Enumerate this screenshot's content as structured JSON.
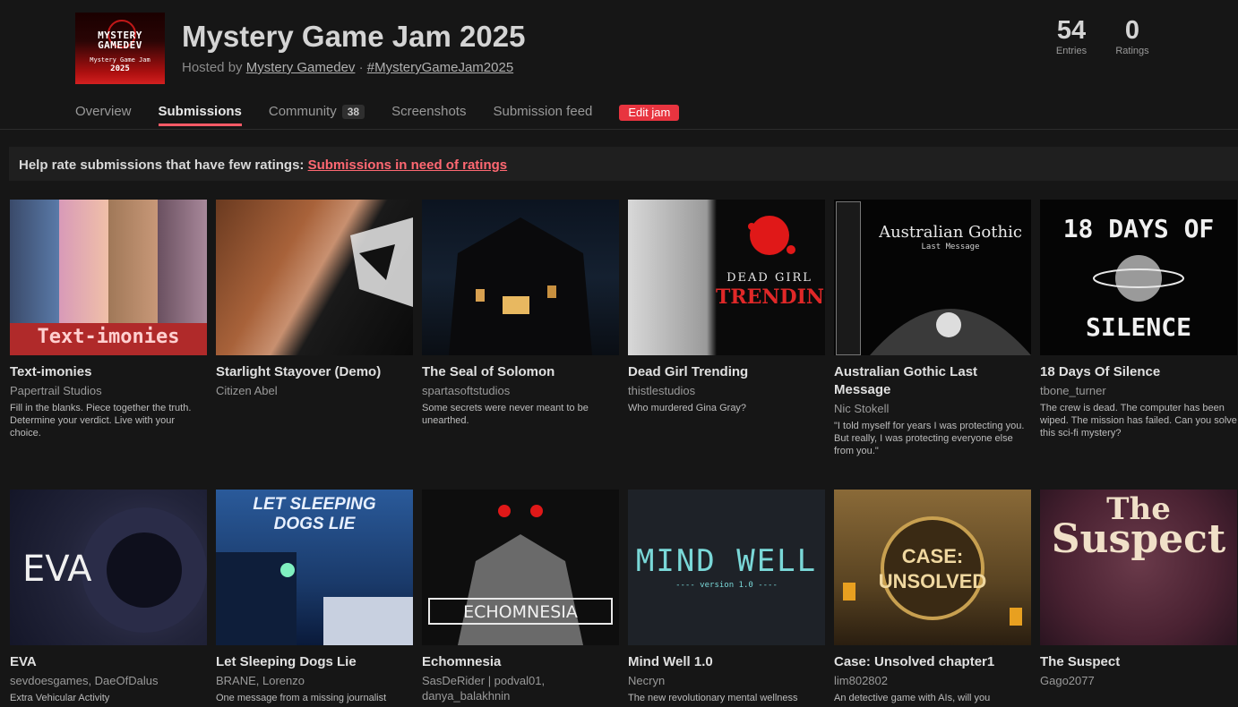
{
  "jam": {
    "title": "Mystery Game Jam 2025",
    "hosted_prefix": "Hosted by ",
    "host": "Mystery Gamedev",
    "separator": " · ",
    "hashtag": "#MysteryGameJam2025",
    "logo": {
      "line1": "MYSTERY",
      "line2": "GAMEDEV",
      "line3": "Mystery Game Jam",
      "line4": "2025"
    }
  },
  "stats": [
    {
      "num": "54",
      "label": "Entries"
    },
    {
      "num": "0",
      "label": "Ratings"
    }
  ],
  "tabs": {
    "overview": "Overview",
    "submissions": "Submissions",
    "community": "Community",
    "community_count": "38",
    "screenshots": "Screenshots",
    "feed": "Submission feed",
    "edit": "Edit jam"
  },
  "help": {
    "text": "Help rate submissions that have few ratings: ",
    "link": "Submissions in need of ratings"
  },
  "colors": {
    "accent": "#ff5a66",
    "button": "#e8343f",
    "background": "#161616"
  },
  "games": [
    {
      "title": "Text-imonies",
      "author": "Papertrail Studios",
      "desc": "Fill in the blanks. Piece together the truth. Determine your verdict. Live with your choice.",
      "thumb_text": "Text-imonies"
    },
    {
      "title": "Starlight Stayover (Demo)",
      "author": "Citizen Abel",
      "desc": ""
    },
    {
      "title": "The Seal of Solomon",
      "author": "spartasoftstudios",
      "desc": "Some secrets were never meant to be unearthed."
    },
    {
      "title": "Dead Girl Trending",
      "author": "thistlestudios",
      "desc": "Who murdered Gina Gray?",
      "thumb_text1": "DEAD GIRL",
      "thumb_text2": "TRENDING"
    },
    {
      "title": "Australian Gothic Last Message",
      "author": "Nic Stokell",
      "desc": "\"I told myself for years I was protecting you. But really, I was protecting everyone else from you.\"",
      "thumb_text1": "Australian Gothic",
      "thumb_text2": "Last Message"
    },
    {
      "title": "18 Days Of Silence",
      "author": "tbone_turner",
      "desc": "The crew is dead. The computer has been wiped. The mission has failed. Can you solve this sci-fi mystery?",
      "thumb_text1": "18 DAYS OF",
      "thumb_text2": "SILENCE"
    },
    {
      "title": "EVA",
      "author": "sevdoesgames, DaeOfDalus",
      "desc": "Extra Vehicular Activity",
      "thumb_text": "EVA"
    },
    {
      "title": "Let Sleeping Dogs Lie",
      "author": "BRANE, Lorenzo",
      "desc": "One message from a missing journalist",
      "thumb_text1": "LET SLEEPING",
      "thumb_text2": "DOGS LIE"
    },
    {
      "title": "Echomnesia",
      "author": "SasDeRider | podval01, danya_balakhnin",
      "desc": "",
      "thumb_text": "ECHOMNESIA"
    },
    {
      "title": "Mind Well 1.0",
      "author": "Necryn",
      "desc": "The new revolutionary mental wellness",
      "thumb_text1": "MIND WELL",
      "thumb_text2": "---- version 1.0 ----"
    },
    {
      "title": "Case: Unsolved chapter1",
      "author": "lim802802",
      "desc": "An detective game with AIs, will you",
      "thumb_text1": "CASE:",
      "thumb_text2": "UNSOLVED"
    },
    {
      "title": "The Suspect",
      "author": "Gago2077",
      "desc": "",
      "thumb_text1": "The",
      "thumb_text2": "Suspect"
    }
  ]
}
